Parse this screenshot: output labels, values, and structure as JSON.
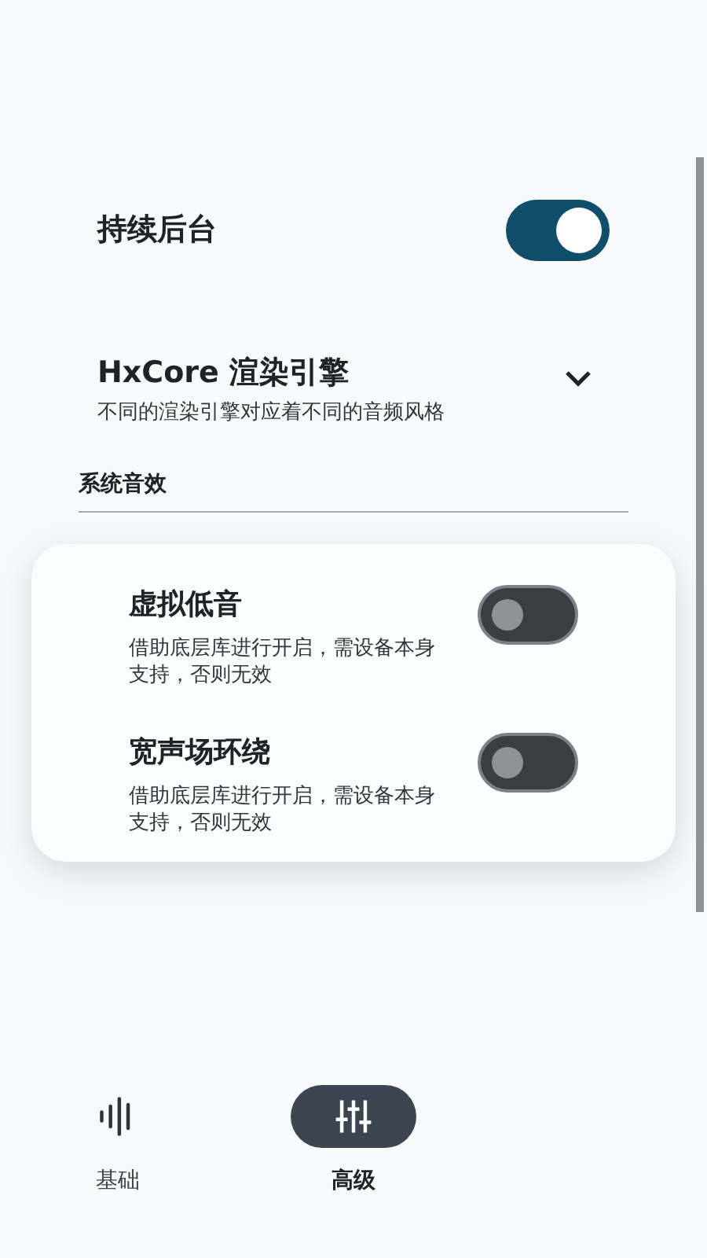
{
  "settings": [
    {
      "kind": "switch",
      "title": "持续后台",
      "on": true
    },
    {
      "kind": "dropdown",
      "title": "HxCore 渲染引擎",
      "subtitle": "不同的渲染引擎对应着不同的音频风格",
      "expanded": false
    }
  ],
  "section": {
    "title": "系统音效",
    "items": [
      {
        "title": "虚拟低音",
        "subtitle": "借助底层库进行开启，需设备本身支持，否则无效",
        "on": false
      },
      {
        "title": "宽声场环绕",
        "subtitle": "借助底层库进行开启，需设备本身支持，否则无效",
        "on": false
      }
    ]
  },
  "nav": [
    {
      "kind": "wave",
      "label": "基础",
      "selected": false
    },
    {
      "kind": "sliders",
      "label": "高级",
      "selected": true
    }
  ]
}
